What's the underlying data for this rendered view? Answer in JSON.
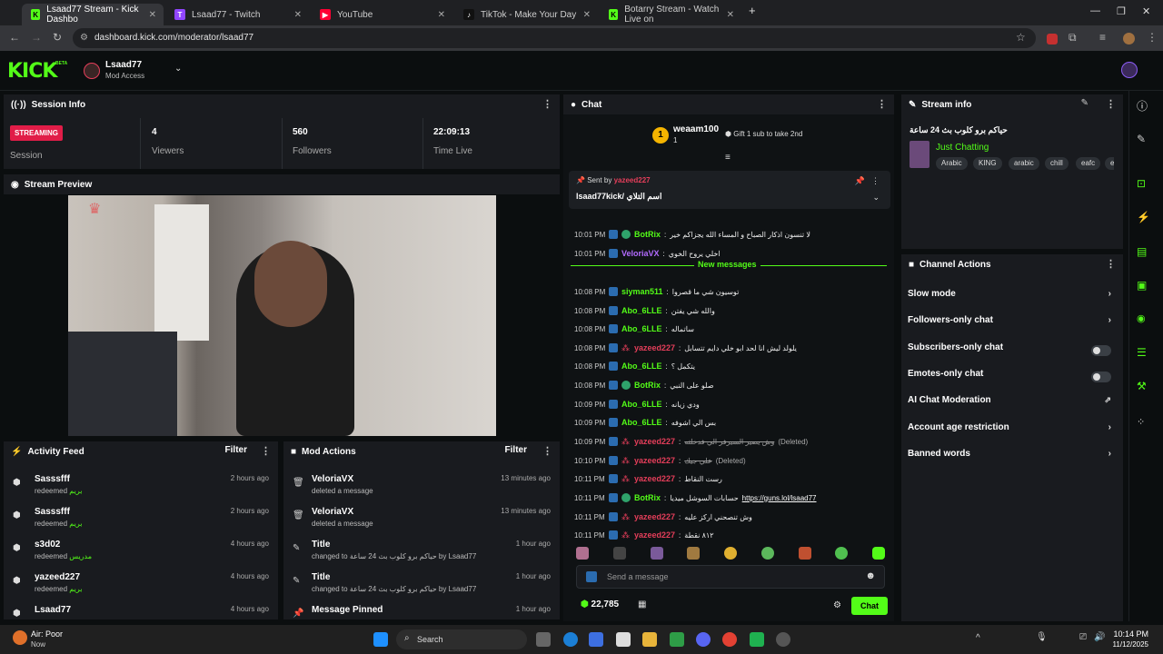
{
  "browser": {
    "tabs": [
      {
        "label": "Lsaad77 Stream - Kick Dashbo",
        "fav": "K",
        "color": "#53fc18"
      },
      {
        "label": "Lsaad77 - Twitch",
        "fav": "T",
        "color": "#9146ff"
      },
      {
        "label": "YouTube",
        "fav": "▶",
        "color": "#ff0033"
      },
      {
        "label": "TikTok - Make Your Day",
        "fav": "♪",
        "color": "#111111"
      },
      {
        "label": "Botarry Stream - Watch Live on",
        "fav": "K",
        "color": "#53fc18"
      }
    ],
    "url": "dashboard.kick.com/moderator/lsaad77"
  },
  "header": {
    "logo": "KICK",
    "beta": "BETA",
    "channel_name": "Lsaad77",
    "access": "Mod Access"
  },
  "session_info": {
    "title": "Session Info",
    "status": "STREAMING",
    "status_label": "Session",
    "viewers": "4",
    "viewers_label": "Viewers",
    "followers": "560",
    "followers_label": "Followers",
    "time_live": "22:09:13",
    "time_live_label": "Time Live"
  },
  "stream_preview": {
    "title": "Stream Preview"
  },
  "activity_feed": {
    "title": "Activity Feed",
    "filter": "Filter",
    "items": [
      {
        "name": "Sasssfff",
        "action": "redeemed",
        "reward": "بريم",
        "time": "2 hours ago"
      },
      {
        "name": "Sasssfff",
        "action": "redeemed",
        "reward": "بريم",
        "time": "2 hours ago"
      },
      {
        "name": "s3d02",
        "action": "redeemed",
        "reward": "مدريس",
        "time": "4 hours ago"
      },
      {
        "name": "yazeed227",
        "action": "redeemed",
        "reward": "بريم",
        "time": "4 hours ago"
      },
      {
        "name": "Lsaad77",
        "action": "",
        "reward": "",
        "time": "4 hours ago"
      }
    ]
  },
  "mod_actions": {
    "title": "Mod Actions",
    "filter": "Filter",
    "items": [
      {
        "icon": "trash",
        "name": "VeloriaVX",
        "detail": "deleted a message",
        "time": "13 minutes ago"
      },
      {
        "icon": "trash",
        "name": "VeloriaVX",
        "detail": "deleted a message",
        "time": "13 minutes ago"
      },
      {
        "icon": "title",
        "name": "Title",
        "detail": "changed to حياكم برو كلوب بث 24 ساعة by Lsaad77",
        "time": "1 hour ago"
      },
      {
        "icon": "title",
        "name": "Title",
        "detail": "changed to حياكم برو كلوب بث 24 ساعة by Lsaad77",
        "time": "1 hour ago"
      },
      {
        "icon": "pin",
        "name": "Message Pinned",
        "detail": "",
        "time": "1 hour ago"
      }
    ]
  },
  "chat": {
    "title": "Chat",
    "gifter_name": "weaam100",
    "gifter_count": "1",
    "gift_cta": "Gift 1 sub to take 2nd",
    "pinned": {
      "sent_by": "Sent by",
      "user": "yazeed227",
      "text": "lsaad77kick/ اسم التلاي"
    },
    "new_messages": "New messages",
    "messages": [
      {
        "time": "10:01 PM",
        "user": "BotRix",
        "color": "#53fc18",
        "text": "لا تنسون اذكار الصباح و المساء الله يجزاكم خير",
        "note": ""
      },
      {
        "time": "10:01 PM",
        "user": "VeloriaVX",
        "color": "#b36bff",
        "text": "اخلي يروح الخوي",
        "note": ""
      },
      {
        "time": "10:08 PM",
        "user": "siyman511",
        "color": "#53fc18",
        "text": "توسيون شي ما قصروا",
        "note": ""
      },
      {
        "time": "10:08 PM",
        "user": "Abo_6LLE",
        "color": "#53fc18",
        "text": "والله شي يفتن",
        "note": ""
      },
      {
        "time": "10:08 PM",
        "user": "Abo_6LLE",
        "color": "#53fc18",
        "text": "ساتماله",
        "note": ""
      },
      {
        "time": "10:08 PM",
        "user": "yazeed227",
        "color": "#e53e5a",
        "text": "يلولد ليش انا لحد ابو خلي دايم تتسابل",
        "note": ""
      },
      {
        "time": "10:08 PM",
        "user": "Abo_6LLE",
        "color": "#53fc18",
        "text": "يتكمل ؟",
        "note": ""
      },
      {
        "time": "10:08 PM",
        "user": "BotRix",
        "color": "#53fc18",
        "text": "صلو على النبي",
        "note": ""
      },
      {
        "time": "10:09 PM",
        "user": "Abo_6LLE",
        "color": "#53fc18",
        "text": "ودي زيانه",
        "note": ""
      },
      {
        "time": "10:09 PM",
        "user": "Abo_6LLE",
        "color": "#53fc18",
        "text": "بس الي اشوفه",
        "note": ""
      },
      {
        "time": "10:09 PM",
        "user": "yazeed227",
        "color": "#e53e5a",
        "text": "وش يصير السيرفر الي فدخلته",
        "note": "(Deleted)"
      },
      {
        "time": "10:10 PM",
        "user": "yazeed227",
        "color": "#e53e5a",
        "text": "علي جيك",
        "note": "(Deleted)"
      },
      {
        "time": "10:11 PM",
        "user": "yazeed227",
        "color": "#e53e5a",
        "text": "رست النقاط",
        "note": ""
      },
      {
        "time": "10:11 PM",
        "user": "BotRix",
        "color": "#53fc18",
        "text": "حسابات السوشل ميديا",
        "note": "https://guns.lol/lsaad77"
      },
      {
        "time": "10:11 PM",
        "user": "yazeed227",
        "color": "#e53e5a",
        "text": "وش تنصحني اركز عليه",
        "note": ""
      },
      {
        "time": "10:11 PM",
        "user": "yazeed227",
        "color": "#e53e5a",
        "text": "٨١٢ نقطة",
        "note": ""
      }
    ],
    "input_placeholder": "Send a message",
    "points": "22,785",
    "send_label": "Chat"
  },
  "stream_info": {
    "title": "Stream info",
    "stream_title": "حياكم برو كلوب بث 24 ساعة",
    "category": "Just Chatting",
    "tags": [
      "Arabic",
      "KING",
      "arabic",
      "chill",
      "eafc",
      "ea"
    ]
  },
  "channel_actions": {
    "title": "Channel Actions",
    "items": [
      {
        "label": "Slow mode",
        "kind": "arrow"
      },
      {
        "label": "Followers-only chat",
        "kind": "arrow"
      },
      {
        "label": "Subscribers-only chat",
        "kind": "toggle"
      },
      {
        "label": "Emotes-only chat",
        "kind": "toggle"
      },
      {
        "label": "AI Chat Moderation",
        "kind": "external"
      },
      {
        "label": "Account age restriction",
        "kind": "arrow"
      },
      {
        "label": "Banned words",
        "kind": "arrow"
      }
    ]
  },
  "taskbar": {
    "weather_title": "Air: Poor",
    "weather_sub": "Now",
    "search": "Search",
    "time": "10:14 PM",
    "date": "11/12/2025"
  },
  "colors": {
    "accent": "#53fc18",
    "streaming": "#e11d48"
  }
}
